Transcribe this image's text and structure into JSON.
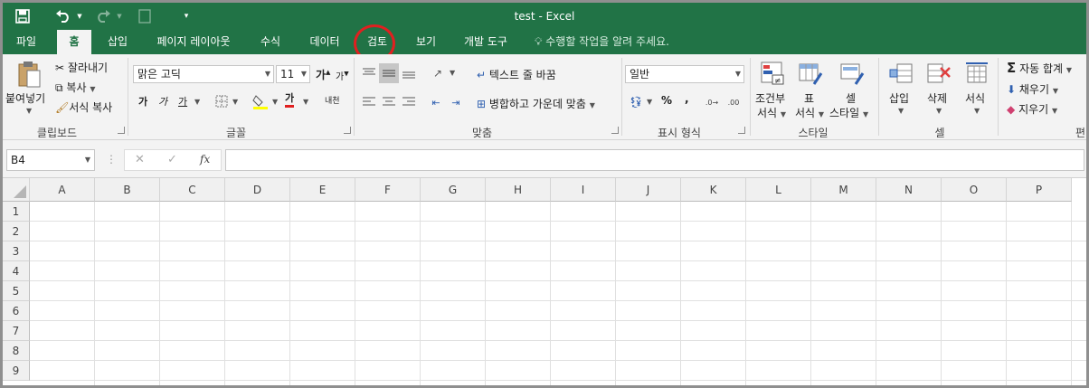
{
  "window": {
    "title": "test - Excel"
  },
  "tabs": [
    {
      "label": "파일",
      "key": "file"
    },
    {
      "label": "홈",
      "key": "home",
      "active": true
    },
    {
      "label": "삽입",
      "key": "insert"
    },
    {
      "label": "페이지 레이아웃",
      "key": "page-layout"
    },
    {
      "label": "수식",
      "key": "formulas"
    },
    {
      "label": "데이터",
      "key": "data"
    },
    {
      "label": "검토",
      "key": "review"
    },
    {
      "label": "보기",
      "key": "view"
    },
    {
      "label": "개발 도구",
      "key": "developer"
    }
  ],
  "tell_me": "수행할 작업을 알려 주세요.",
  "clipboard": {
    "paste": "붙여넣기",
    "cut": "잘라내기",
    "copy": "복사",
    "format_painter": "서식 복사",
    "group": "클립보드"
  },
  "font": {
    "name": "맑은 고딕",
    "size": "11",
    "grow": "가",
    "shrink": "가",
    "bold": "가",
    "italic": "가",
    "underline": "가",
    "font_color": "가",
    "phonetic": "내천",
    "group": "글꼴"
  },
  "alignment": {
    "wrap_text": "텍스트 줄 바꿈",
    "merge_center": "병합하고 가운데 맞춤",
    "group": "맞춤"
  },
  "number": {
    "format": "일반",
    "percent": "%",
    "comma": ",",
    "group": "표시 형식"
  },
  "styles": {
    "conditional_1": "조건부",
    "conditional_2": "서식",
    "table_1": "표",
    "table_2": "서식",
    "cell_1": "셀",
    "cell_2": "스타일",
    "group": "스타일"
  },
  "cells": {
    "insert": "삽입",
    "delete": "삭제",
    "format": "서식",
    "group": "셀"
  },
  "editing": {
    "autosum": "자동 합계",
    "fill": "채우기",
    "clear": "지우기",
    "group": "편"
  },
  "formula_bar": {
    "name_box": "B4",
    "fx": "fx",
    "value": ""
  },
  "sheet": {
    "columns": [
      "A",
      "B",
      "C",
      "D",
      "E",
      "F",
      "G",
      "H",
      "I",
      "J",
      "K",
      "L",
      "M",
      "N",
      "O",
      "P"
    ],
    "rows": [
      "1",
      "2",
      "3",
      "4",
      "5",
      "6",
      "7",
      "8",
      "9"
    ]
  },
  "colors": {
    "accent": "#217346",
    "annotation": "#e02020"
  }
}
